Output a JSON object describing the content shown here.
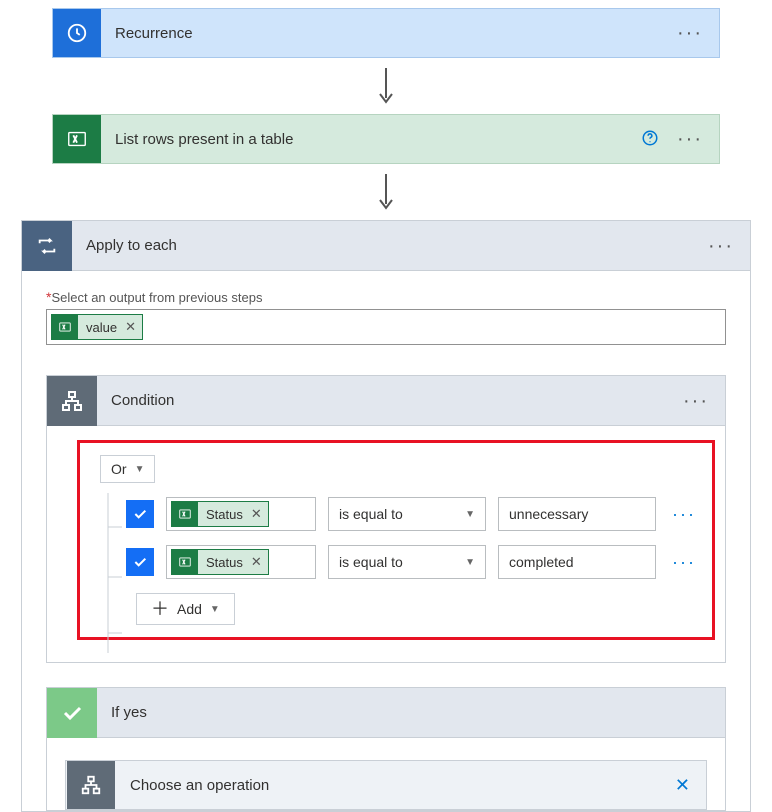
{
  "recurrence": {
    "title": "Recurrence"
  },
  "excel": {
    "title": "List rows present in a table"
  },
  "apply": {
    "title": "Apply to each",
    "select_output_label": "Select an output from previous steps",
    "output_chip": "value"
  },
  "condition": {
    "title": "Condition",
    "logic": "Or",
    "rows": [
      {
        "field": "Status",
        "operator": "is equal to",
        "value": "unnecessary"
      },
      {
        "field": "Status",
        "operator": "is equal to",
        "value": "completed"
      }
    ],
    "add_label": "Add"
  },
  "ifyes": {
    "title": "If yes",
    "choose_operation": "Choose an operation"
  }
}
